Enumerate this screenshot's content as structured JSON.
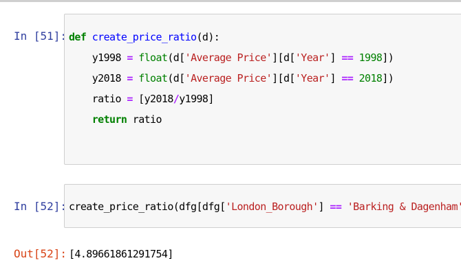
{
  "cells": [
    {
      "prompt": "In [51]:",
      "code_lines": [
        [
          "def",
          " ",
          "create_price_ratio",
          "(d):"
        ],
        [
          "    y1998 ",
          "=",
          " ",
          "float",
          "(d[",
          "'Average Price'",
          "][d[",
          "'Year'",
          "] ",
          "==",
          " ",
          "1998",
          "])"
        ],
        [
          "    y2018 ",
          "=",
          " ",
          "float",
          "(d[",
          "'Average Price'",
          "][d[",
          "'Year'",
          "] ",
          "==",
          " ",
          "2018",
          "])"
        ],
        [
          "    ratio ",
          "=",
          " [y2018",
          "/",
          "y1998]"
        ],
        [
          "    ",
          "return",
          " ratio"
        ]
      ]
    },
    {
      "prompt": "In [52]:",
      "code_lines": [
        [
          "create_price_ratio(dfg[dfg[",
          "'London_Borough'",
          "] ",
          "==",
          " ",
          "'Barking & Dagenham'",
          "])"
        ]
      ]
    },
    {
      "prompt": "Out[52]:",
      "output": "[4.89661861291754]"
    }
  ],
  "colors": {
    "in_prompt": "#303F9F",
    "out_prompt": "#D84315",
    "keyword": "#008000",
    "function_name": "#0000FF",
    "string": "#BA2121",
    "operator": "#AA22FF",
    "number": "#008000",
    "cell_background": "#f7f7f7",
    "cell_border": "#cfcfcf"
  }
}
